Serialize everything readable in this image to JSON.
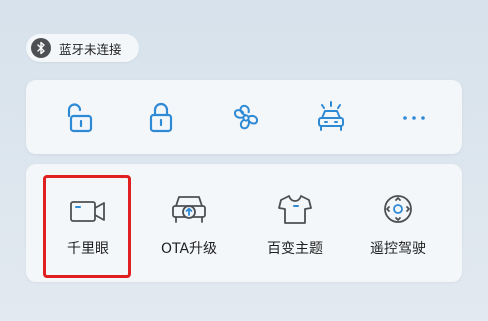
{
  "bluetooth": {
    "status_label": "蓝牙未连接",
    "icon": "bluetooth-icon"
  },
  "quick_actions": [
    {
      "id": "unlock",
      "icon": "unlock-icon"
    },
    {
      "id": "lock",
      "icon": "lock-icon"
    },
    {
      "id": "fan",
      "icon": "fan-icon"
    },
    {
      "id": "car-lights",
      "icon": "car-lights-icon"
    },
    {
      "id": "more",
      "icon": "more-icon"
    }
  ],
  "functions": [
    {
      "id": "qianliyan",
      "label": "千里眼",
      "icon": "camera-icon",
      "highlighted": true
    },
    {
      "id": "ota",
      "label": "OTA升级",
      "icon": "ota-upgrade-icon"
    },
    {
      "id": "theme",
      "label": "百变主题",
      "icon": "shirt-icon"
    },
    {
      "id": "remote-drive",
      "label": "遥控驾驶",
      "icon": "remote-drive-icon"
    }
  ],
  "colors": {
    "accent": "#2f8ad6",
    "icon_gray": "#4d4f52",
    "highlight_border": "#e02020",
    "card_bg": "#f4f7fa"
  }
}
